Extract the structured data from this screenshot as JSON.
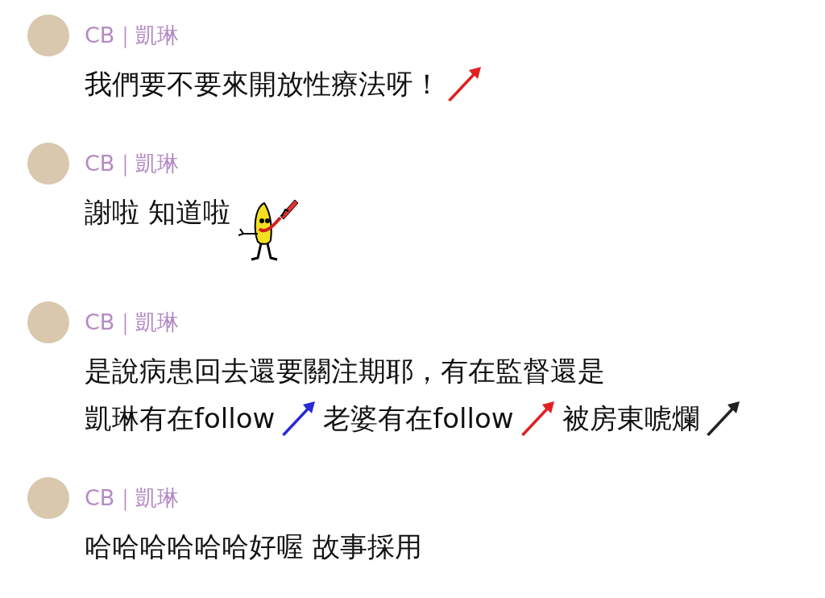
{
  "messages": [
    {
      "sender": "CB｜凱琳",
      "lines": [
        [
          {
            "kind": "text",
            "text": "我們要不要來開放性療法呀！"
          },
          {
            "kind": "horn",
            "color": "#e02020"
          }
        ]
      ]
    },
    {
      "sender": "CB｜凱琳",
      "lines": [
        [
          {
            "kind": "text",
            "text": "謝啦 知道啦"
          },
          {
            "kind": "sticker"
          }
        ]
      ]
    },
    {
      "sender": "CB｜凱琳",
      "lines": [
        [
          {
            "kind": "text",
            "text": "是說病患回去還要關注期耶，有在監督還是"
          }
        ],
        [
          {
            "kind": "text",
            "text": "凱琳有在follow"
          },
          {
            "kind": "horn",
            "color": "#2a2ad8"
          },
          {
            "kind": "text",
            "text": "老婆有在follow"
          },
          {
            "kind": "horn",
            "color": "#e02020"
          },
          {
            "kind": "text",
            "text": "被房東唬爛"
          },
          {
            "kind": "horn",
            "color": "#222222"
          }
        ]
      ]
    },
    {
      "sender": "CB｜凱琳",
      "lines": [
        [
          {
            "kind": "text",
            "text": "哈哈哈哈哈哈好喔 故事採用"
          }
        ]
      ]
    }
  ]
}
